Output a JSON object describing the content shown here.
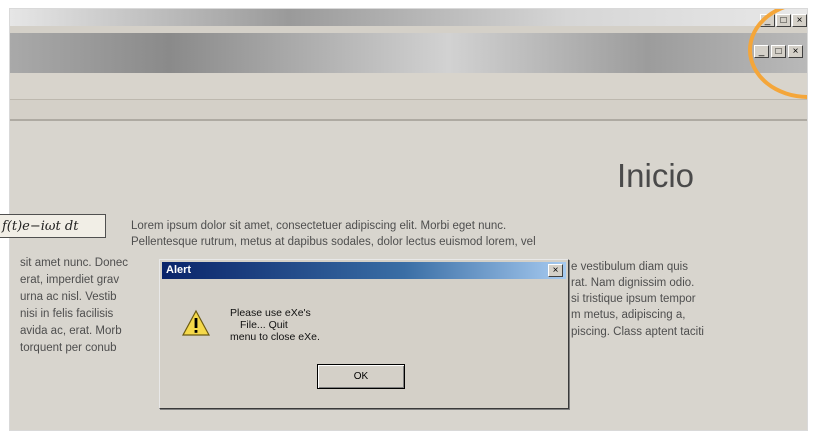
{
  "outer_window": {
    "controls": [
      "_",
      "□",
      "×"
    ]
  },
  "window": {
    "minimize_label": "_",
    "maximize_label": "□",
    "close_label": "×"
  },
  "page": {
    "heading": "Inicio",
    "formula": "f(t)e−iωt dt",
    "lines": [
      "Lorem ipsum dolor sit amet, consectetuer adipiscing elit. Morbi eget nunc.",
      "Pellentesque rutrum, metus at dapibus sodales, dolor lectus euismod lorem, vel",
      "sit amet nunc. Donec",
      "erat, imperdiet grav",
      "urna ac nisl. Vestib",
      "nisi in felis facilisis",
      "avida ac, erat. Morb",
      "torquent per conub",
      "e vestibulum diam quis",
      "rat. Nam dignissim odio.",
      "si tristique ipsum tempor",
      "m metus, adipiscing a,",
      "piscing. Class aptent taciti"
    ]
  },
  "dialog": {
    "title": "Alert",
    "close_label": "×",
    "message_lines": [
      "Please use eXe's",
      "File... Quit",
      "menu to close eXe."
    ],
    "ok_label": "OK",
    "icon": "warning-icon"
  },
  "colors": {
    "dialog_title_start": "#0a246a",
    "dialog_title_end": "#a6caf0",
    "highlight_ring": "#f4a63a"
  }
}
